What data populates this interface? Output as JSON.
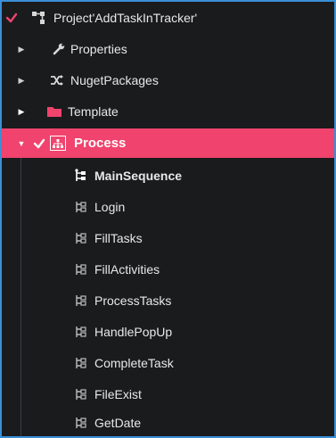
{
  "tree": {
    "project": {
      "label": "Project'AddTaskInTracker'",
      "icon": "workflow-icon",
      "checked": true
    },
    "properties": {
      "label": "Properties",
      "icon": "wrench-icon"
    },
    "nuget": {
      "label": "NugetPackages",
      "icon": "shuffle-icon"
    },
    "template": {
      "label": "Template",
      "icon": "folder-icon"
    },
    "process": {
      "label": "Process",
      "icon": "org-chart-icon",
      "checked": true,
      "expanded": true
    },
    "process_items": [
      {
        "label": "MainSequence",
        "icon": "sequence-icon",
        "bold": true
      },
      {
        "label": "Login",
        "icon": "sequence-icon"
      },
      {
        "label": "FillTasks",
        "icon": "sequence-icon"
      },
      {
        "label": "FillActivities",
        "icon": "sequence-icon"
      },
      {
        "label": "ProcessTasks",
        "icon": "sequence-icon"
      },
      {
        "label": "HandlePopUp",
        "icon": "sequence-icon"
      },
      {
        "label": "CompleteTask",
        "icon": "sequence-icon"
      },
      {
        "label": "FileExist",
        "icon": "sequence-icon"
      },
      {
        "label": "GetDate",
        "icon": "sequence-icon"
      }
    ]
  },
  "colors": {
    "background": "#1a1b1d",
    "selected": "#f0436d",
    "check": "#f0436d",
    "folder": "#f0436d",
    "border": "#3a8fd6"
  }
}
